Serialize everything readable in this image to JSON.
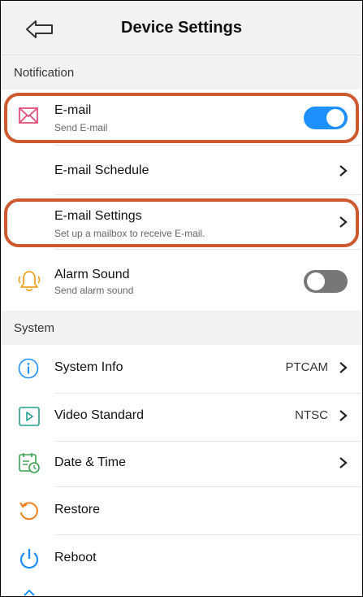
{
  "header": {
    "title": "Device Settings",
    "back_icon": "back-arrow-icon"
  },
  "sections": {
    "notification": "Notification",
    "system": "System"
  },
  "notification_items": {
    "email": {
      "label": "E-mail",
      "sub": "Send E-mail",
      "icon": "mail-icon",
      "enabled": true
    },
    "email_schedule": {
      "label": "E-mail Schedule"
    },
    "email_settings": {
      "label": "E-mail Settings",
      "sub": "Set up a mailbox to receive E-mail."
    },
    "alarm_sound": {
      "label": "Alarm Sound",
      "sub": "Send alarm sound",
      "icon": "bell-icon",
      "enabled": false
    }
  },
  "system_items": {
    "system_info": {
      "label": "System Info",
      "value": "PTCAM",
      "icon": "info-icon"
    },
    "video_standard": {
      "label": "Video Standard",
      "value": "NTSC",
      "icon": "play-icon"
    },
    "date_time": {
      "label": "Date & Time",
      "icon": "calendar-icon"
    },
    "restore": {
      "label": "Restore",
      "icon": "restore-icon"
    },
    "reboot": {
      "label": "Reboot",
      "icon": "power-icon"
    }
  },
  "colors": {
    "accent": "#1e90ff",
    "highlight": "#cc5a2e",
    "mail": "#e0507a",
    "bell": "#f0a020",
    "restore": "#f08020"
  }
}
